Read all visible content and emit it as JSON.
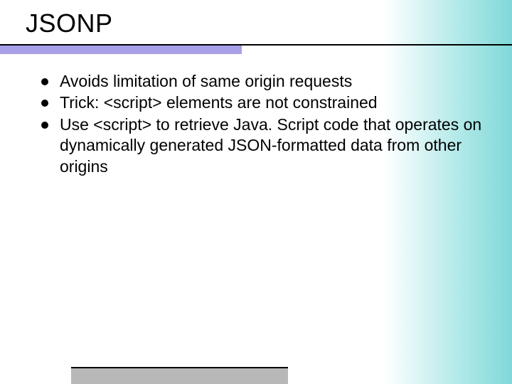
{
  "slide": {
    "title": "JSONP",
    "bullets": [
      "Avoids limitation of same origin requests",
      "Trick: <script> elements are not constrained",
      "Use <script> to retrieve Java. Script code that operates on dynamically generated JSON-formatted data from other origins"
    ]
  }
}
